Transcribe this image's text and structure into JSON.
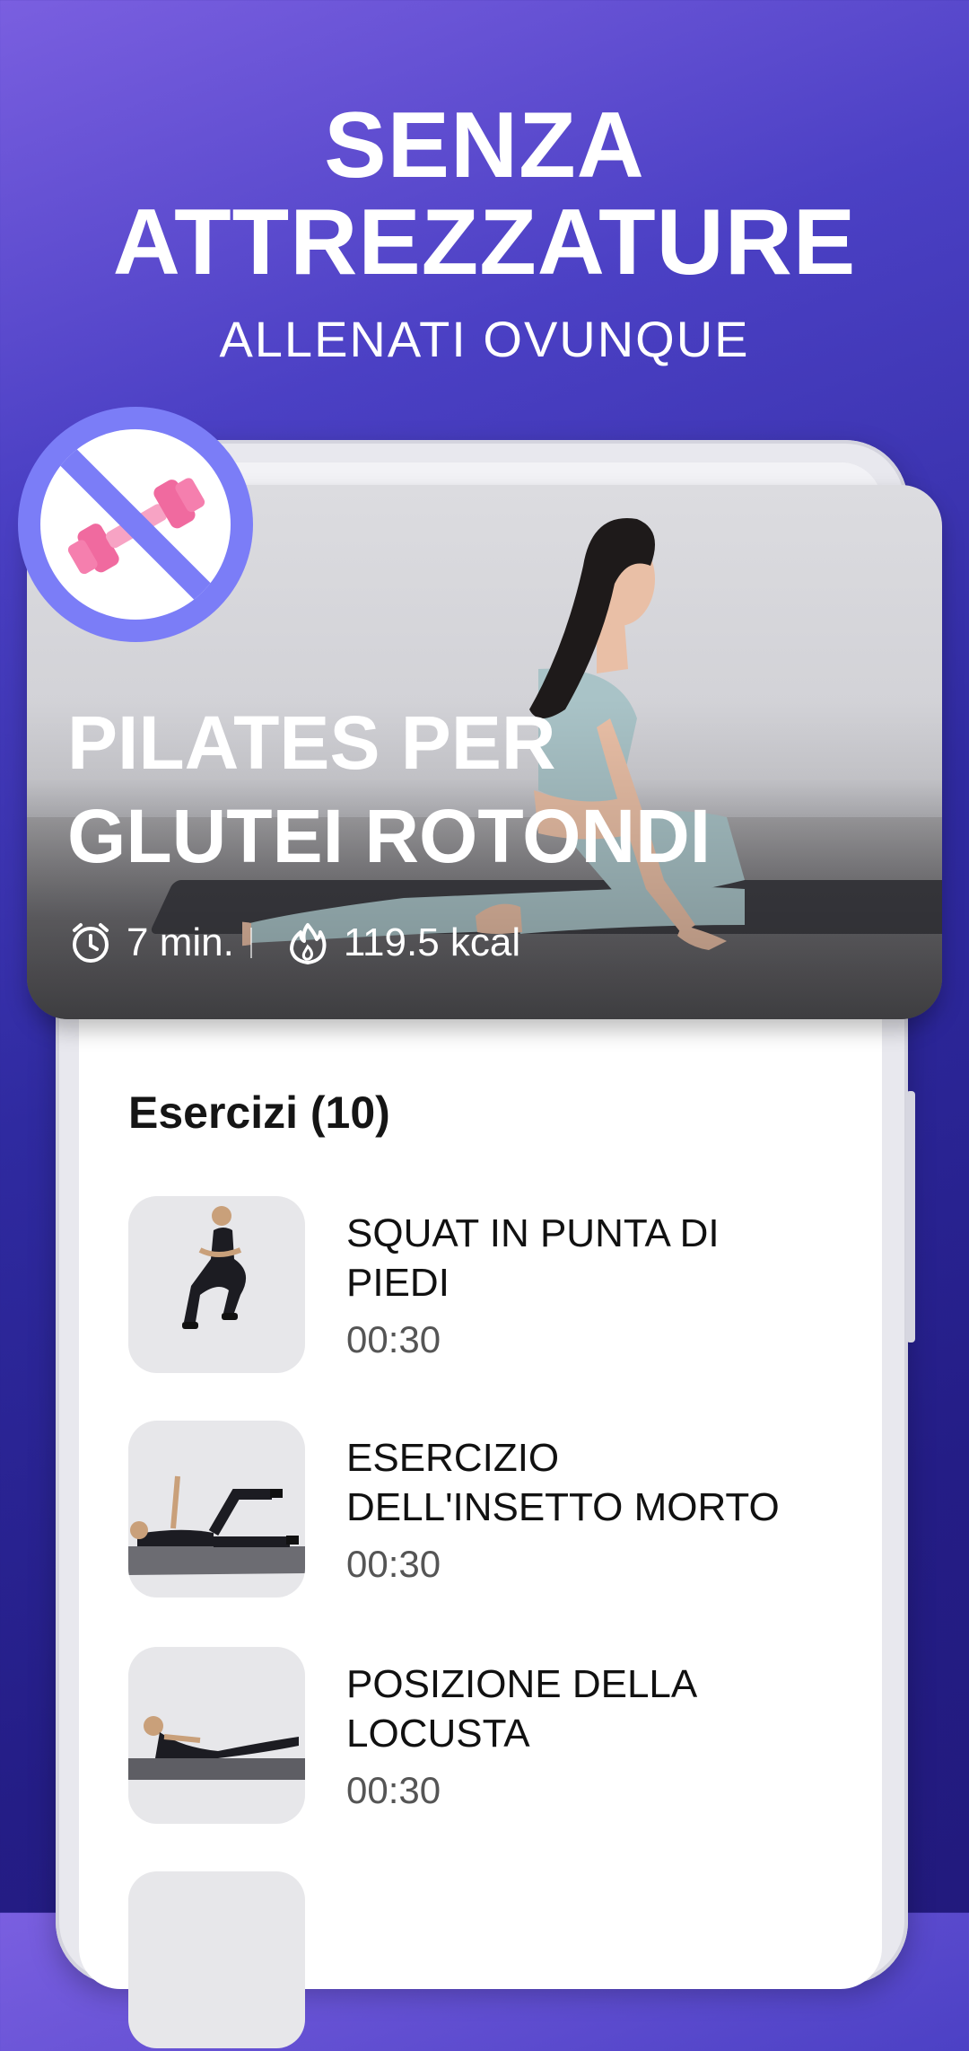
{
  "promo": {
    "headline": "SENZA\nATTREZZATURE",
    "subheadline": "ALLENATI OVUNQUE"
  },
  "badge": {
    "icon": "no-dumbbell-icon"
  },
  "workout": {
    "title": "PILATES PER\nGLUTEI ROTONDI",
    "duration": "7 min.",
    "calories": "119.5 kcal",
    "duration_icon": "alarm-clock-icon",
    "calories_icon": "flame-icon"
  },
  "exercises": {
    "header": "Esercizi (10)",
    "items": [
      {
        "name": "SQUAT IN PUNTA DI\nPIEDI",
        "time": "00:30"
      },
      {
        "name": "ESERCIZIO\nDELL'INSETTO MORTO",
        "time": "00:30"
      },
      {
        "name": "POSIZIONE DELLA\nLOCUSTA",
        "time": "00:30"
      },
      {
        "name": "",
        "time": ""
      }
    ]
  },
  "colors": {
    "background_top": "#7a5fe0",
    "background_bottom": "#221a7d",
    "badge_ring": "#7b7df7",
    "dumbbell": "#f57fae"
  }
}
